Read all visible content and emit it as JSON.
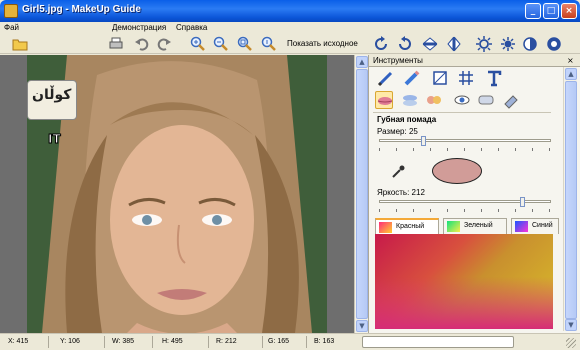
{
  "window": {
    "title": "Girl5.jpg - MakeUp Guide"
  },
  "menu": {
    "items": [
      "Фай",
      "Демонстрация",
      "Справка"
    ]
  },
  "toolbar": {
    "show_original_label": "Показать исходное"
  },
  "photo": {
    "logo_text": "کوڵان",
    "logo2_text": "IT"
  },
  "panel": {
    "title": "Инструменты",
    "close": "×",
    "section": "Губная помада",
    "size_label": "Размер: 25",
    "size_value": 25,
    "brightness_label": "Яркость: 212",
    "brightness_value": 212,
    "swatch_color": "#D19C98",
    "tabs": [
      {
        "label": "Красный",
        "active": true,
        "icon_gradient": [
          "#FF2B7A",
          "#FFD12E"
        ]
      },
      {
        "label": "Зеленый",
        "active": false,
        "icon_gradient": [
          "#13E17B",
          "#F7F049"
        ]
      },
      {
        "label": "Синий",
        "active": false,
        "icon_gradient": [
          "#1A55FF",
          "#FF32D6"
        ]
      }
    ]
  },
  "status": {
    "x": "X: 415",
    "y": "Y: 106",
    "w": "W: 385",
    "h": "H: 495",
    "r": "R: 212",
    "g": "G: 165",
    "b": "B: 163"
  }
}
